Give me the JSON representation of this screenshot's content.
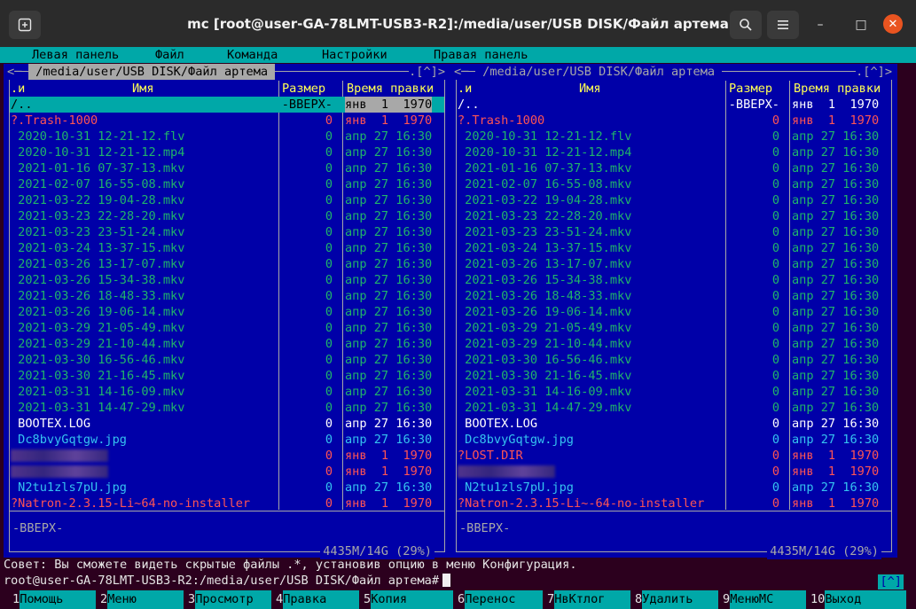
{
  "window": {
    "title": "mc [root@user-GA-78LMT-USB3-R2]:/media/user/USB DISK/Файл артема",
    "new_tab_icon": "terminal-plus-icon",
    "search_icon": "search-icon",
    "menu_icon": "hamburger-icon",
    "minimize": "–",
    "maximize": "□",
    "close": "✕"
  },
  "menubar": {
    "left": "Левая панель",
    "file": "Файл",
    "command": "Команда",
    "options": "Настройки",
    "right": "Правая панель"
  },
  "left_panel": {
    "path": " /media/user/USB DISK/Файл артема ",
    "corner_left": "<─",
    "corner_right": ".[^]>",
    "columns": {
      "sort": ".и",
      "name": "Имя",
      "size": "Размер",
      "mtime": "Время правки"
    },
    "bottom_info": "-ВВЕРХ-",
    "disk_info": "4435M/14G (29%)",
    "rows": [
      {
        "name": "/..",
        "size": "-ВВЕРХ-",
        "mtime": "янв  1  1970",
        "kind": "sel"
      },
      {
        "name": "?.Trash-1000",
        "size": "0",
        "mtime": "янв  1  1970",
        "kind": "broken"
      },
      {
        "name": " 2020-10-31 12-21-12.flv",
        "size": "0",
        "mtime": "апр 27 16:30",
        "kind": "media"
      },
      {
        "name": " 2020-10-31 12-21-12.mp4",
        "size": "0",
        "mtime": "апр 27 16:30",
        "kind": "media"
      },
      {
        "name": " 2021-01-16 07-37-13.mkv",
        "size": "0",
        "mtime": "апр 27 16:30",
        "kind": "media"
      },
      {
        "name": " 2021-02-07 16-55-08.mkv",
        "size": "0",
        "mtime": "апр 27 16:30",
        "kind": "media"
      },
      {
        "name": " 2021-03-22 19-04-28.mkv",
        "size": "0",
        "mtime": "апр 27 16:30",
        "kind": "media"
      },
      {
        "name": " 2021-03-23 22-28-20.mkv",
        "size": "0",
        "mtime": "апр 27 16:30",
        "kind": "media"
      },
      {
        "name": " 2021-03-23 23-51-24.mkv",
        "size": "0",
        "mtime": "апр 27 16:30",
        "kind": "media"
      },
      {
        "name": " 2021-03-24 13-37-15.mkv",
        "size": "0",
        "mtime": "апр 27 16:30",
        "kind": "media"
      },
      {
        "name": " 2021-03-26 13-17-07.mkv",
        "size": "0",
        "mtime": "апр 27 16:30",
        "kind": "media"
      },
      {
        "name": " 2021-03-26 15-34-38.mkv",
        "size": "0",
        "mtime": "апр 27 16:30",
        "kind": "media"
      },
      {
        "name": " 2021-03-26 18-48-33.mkv",
        "size": "0",
        "mtime": "апр 27 16:30",
        "kind": "media"
      },
      {
        "name": " 2021-03-26 19-06-14.mkv",
        "size": "0",
        "mtime": "апр 27 16:30",
        "kind": "media"
      },
      {
        "name": " 2021-03-29 21-05-49.mkv",
        "size": "0",
        "mtime": "апр 27 16:30",
        "kind": "media"
      },
      {
        "name": " 2021-03-29 21-10-44.mkv",
        "size": "0",
        "mtime": "апр 27 16:30",
        "kind": "media"
      },
      {
        "name": " 2021-03-30 16-56-46.mkv",
        "size": "0",
        "mtime": "апр 27 16:30",
        "kind": "media"
      },
      {
        "name": " 2021-03-30 21-16-45.mkv",
        "size": "0",
        "mtime": "апр 27 16:30",
        "kind": "media"
      },
      {
        "name": " 2021-03-31 14-16-09.mkv",
        "size": "0",
        "mtime": "апр 27 16:30",
        "kind": "media"
      },
      {
        "name": " 2021-03-31 14-47-29.mkv",
        "size": "0",
        "mtime": "апр 27 16:30",
        "kind": "media"
      },
      {
        "name": " BOOTEX.LOG",
        "size": "0",
        "mtime": "апр 27 16:30",
        "kind": "plain"
      },
      {
        "name": " Dc8bvyGqtgw.jpg",
        "size": "0",
        "mtime": "апр 27 16:30",
        "kind": "image"
      },
      {
        "name": "",
        "size": "0",
        "mtime": "янв  1  1970",
        "kind": "blurred"
      },
      {
        "name": "",
        "size": "0",
        "mtime": "янв  1  1970",
        "kind": "blurred"
      },
      {
        "name": " N2tu1zls7pU.jpg",
        "size": "0",
        "mtime": "апр 27 16:30",
        "kind": "image"
      },
      {
        "name": "?Natron-2.3.15-Li~64-no-installer",
        "size": "0",
        "mtime": "янв  1  1970",
        "kind": "broken"
      }
    ]
  },
  "right_panel": {
    "path": " /media/user/USB DISK/Файл артема ",
    "corner_left": "<─",
    "corner_right": ".[^]>",
    "columns": {
      "sort": ".и",
      "name": "Имя",
      "size": "Размер",
      "mtime": "Время правки"
    },
    "bottom_info": "-ВВЕРХ-",
    "disk_info": "4435M/14G (29%)",
    "rows": [
      {
        "name": "/..",
        "size": "-ВВЕРХ-",
        "mtime": "янв  1  1970",
        "kind": "plain"
      },
      {
        "name": "?.Trash-1000",
        "size": "0",
        "mtime": "янв  1  1970",
        "kind": "broken"
      },
      {
        "name": " 2020-10-31 12-21-12.flv",
        "size": "0",
        "mtime": "апр 27 16:30",
        "kind": "media"
      },
      {
        "name": " 2020-10-31 12-21-12.mp4",
        "size": "0",
        "mtime": "апр 27 16:30",
        "kind": "media"
      },
      {
        "name": " 2021-01-16 07-37-13.mkv",
        "size": "0",
        "mtime": "апр 27 16:30",
        "kind": "media"
      },
      {
        "name": " 2021-02-07 16-55-08.mkv",
        "size": "0",
        "mtime": "апр 27 16:30",
        "kind": "media"
      },
      {
        "name": " 2021-03-22 19-04-28.mkv",
        "size": "0",
        "mtime": "апр 27 16:30",
        "kind": "media"
      },
      {
        "name": " 2021-03-23 22-28-20.mkv",
        "size": "0",
        "mtime": "апр 27 16:30",
        "kind": "media"
      },
      {
        "name": " 2021-03-23 23-51-24.mkv",
        "size": "0",
        "mtime": "апр 27 16:30",
        "kind": "media"
      },
      {
        "name": " 2021-03-24 13-37-15.mkv",
        "size": "0",
        "mtime": "апр 27 16:30",
        "kind": "media"
      },
      {
        "name": " 2021-03-26 13-17-07.mkv",
        "size": "0",
        "mtime": "апр 27 16:30",
        "kind": "media"
      },
      {
        "name": " 2021-03-26 15-34-38.mkv",
        "size": "0",
        "mtime": "апр 27 16:30",
        "kind": "media"
      },
      {
        "name": " 2021-03-26 18-48-33.mkv",
        "size": "0",
        "mtime": "апр 27 16:30",
        "kind": "media"
      },
      {
        "name": " 2021-03-26 19-06-14.mkv",
        "size": "0",
        "mtime": "апр 27 16:30",
        "kind": "media"
      },
      {
        "name": " 2021-03-29 21-05-49.mkv",
        "size": "0",
        "mtime": "апр 27 16:30",
        "kind": "media"
      },
      {
        "name": " 2021-03-29 21-10-44.mkv",
        "size": "0",
        "mtime": "апр 27 16:30",
        "kind": "media"
      },
      {
        "name": " 2021-03-30 16-56-46.mkv",
        "size": "0",
        "mtime": "апр 27 16:30",
        "kind": "media"
      },
      {
        "name": " 2021-03-30 21-16-45.mkv",
        "size": "0",
        "mtime": "апр 27 16:30",
        "kind": "media"
      },
      {
        "name": " 2021-03-31 14-16-09.mkv",
        "size": "0",
        "mtime": "апр 27 16:30",
        "kind": "media"
      },
      {
        "name": " 2021-03-31 14-47-29.mkv",
        "size": "0",
        "mtime": "апр 27 16:30",
        "kind": "media"
      },
      {
        "name": " BOOTEX.LOG",
        "size": "0",
        "mtime": "апр 27 16:30",
        "kind": "plain"
      },
      {
        "name": " Dc8bvyGqtgw.jpg",
        "size": "0",
        "mtime": "апр 27 16:30",
        "kind": "image"
      },
      {
        "name": "?LOST.DIR",
        "size": "0",
        "mtime": "янв  1  1970",
        "kind": "broken"
      },
      {
        "name": "",
        "size": "0",
        "mtime": "янв  1  1970",
        "kind": "blurred"
      },
      {
        "name": " N2tu1zls7pU.jpg",
        "size": "0",
        "mtime": "апр 27 16:30",
        "kind": "image"
      },
      {
        "name": "?Natron-2.3.15-Li~-64-no-installer",
        "size": "0",
        "mtime": "янв  1  1970",
        "kind": "broken"
      }
    ]
  },
  "hint": "Совет: Вы сможете видеть скрытые файлы .*, установив опцию в меню Конфигурация.",
  "prompt": "root@user-GA-78LMT-USB3-R2:/media/user/USB DISK/Файл артема#",
  "prompt_button": "[^]",
  "fkeys": [
    {
      "n": "1",
      "label": "Помощь"
    },
    {
      "n": "2",
      "label": "Меню"
    },
    {
      "n": "3",
      "label": "Просмотр"
    },
    {
      "n": "4",
      "label": "Правка"
    },
    {
      "n": "5",
      "label": "Копия"
    },
    {
      "n": "6",
      "label": "Перенос"
    },
    {
      "n": "7",
      "label": "НвКтлог"
    },
    {
      "n": "8",
      "label": "Удалить"
    },
    {
      "n": "9",
      "label": "МенюMC"
    },
    {
      "n": "10",
      "label": "Выход"
    }
  ],
  "colors": {
    "panel_bg": "#0000a8",
    "selection": "#00a8a8",
    "header_yellow": "#ffff54",
    "media_green": "#20b46a",
    "broken_red": "#ff5454",
    "image_cyan": "#35c3f0",
    "plain_white": "#ffffff",
    "terminal_bg": "#2c001e"
  }
}
